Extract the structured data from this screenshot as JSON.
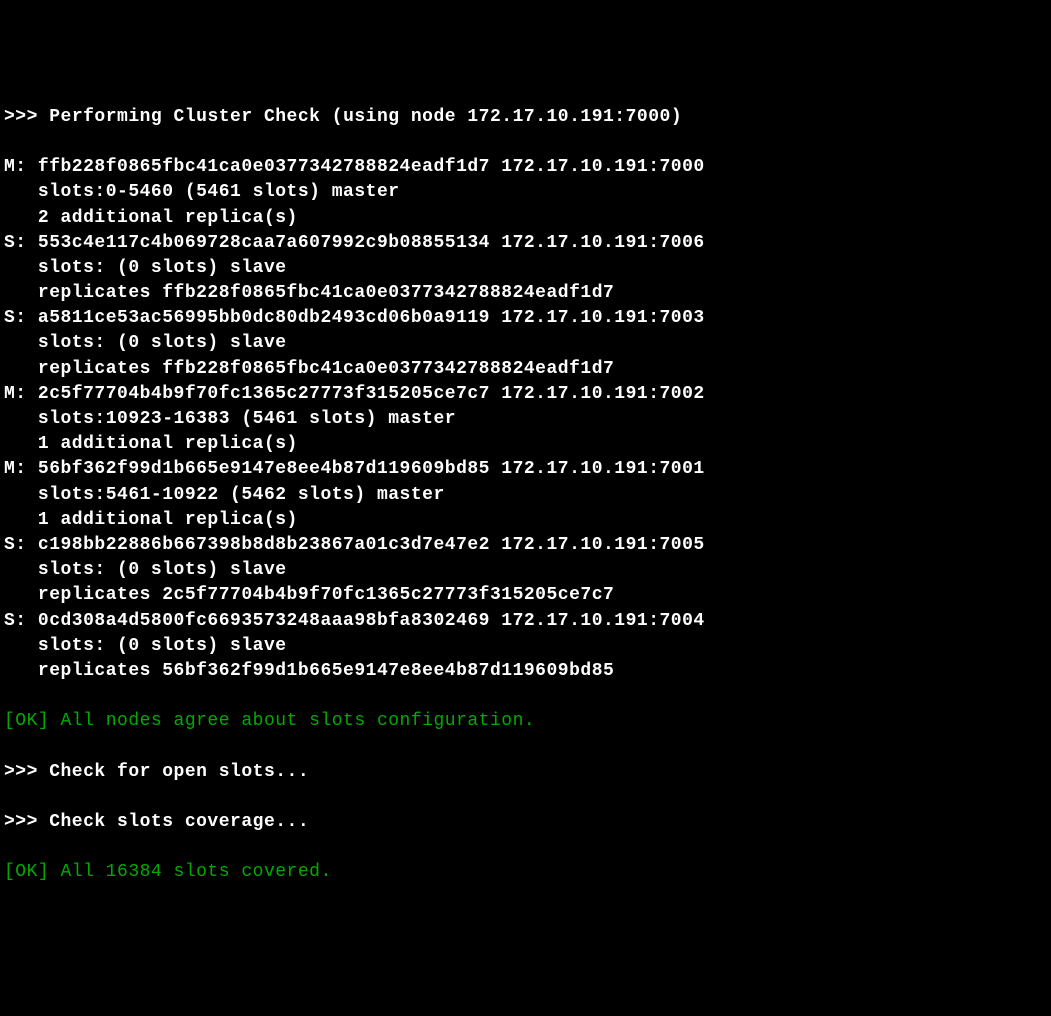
{
  "header": {
    "prefix": ">>> ",
    "title": "Performing Cluster Check (using node 172.17.10.191:7000)"
  },
  "nodes": [
    {
      "role": "M",
      "id": "ffb228f0865fbc41ca0e0377342788824eadf1d7",
      "address": "172.17.10.191:7000",
      "slots_line": "   slots:0-5460 (5461 slots) master",
      "replica_line": "   2 additional replica(s)"
    },
    {
      "role": "S",
      "id": "553c4e117c4b069728caa7a607992c9b08855134",
      "address": "172.17.10.191:7006",
      "slots_line": "   slots: (0 slots) slave",
      "replicates_line": "   replicates ffb228f0865fbc41ca0e0377342788824eadf1d7"
    },
    {
      "role": "S",
      "id": "a5811ce53ac56995bb0dc80db2493cd06b0a9119",
      "address": "172.17.10.191:7003",
      "slots_line": "   slots: (0 slots) slave",
      "replicates_line": "   replicates ffb228f0865fbc41ca0e0377342788824eadf1d7"
    },
    {
      "role": "M",
      "id": "2c5f77704b4b9f70fc1365c27773f315205ce7c7",
      "address": "172.17.10.191:7002",
      "slots_line": "   slots:10923-16383 (5461 slots) master",
      "replica_line": "   1 additional replica(s)"
    },
    {
      "role": "M",
      "id": "56bf362f99d1b665e9147e8ee4b87d119609bd85",
      "address": "172.17.10.191:7001",
      "slots_line": "   slots:5461-10922 (5462 slots) master",
      "replica_line": "   1 additional replica(s)"
    },
    {
      "role": "S",
      "id": "c198bb22886b667398b8d8b23867a01c3d7e47e2",
      "address": "172.17.10.191:7005",
      "slots_line": "   slots: (0 slots) slave",
      "replicates_line": "   replicates 2c5f77704b4b9f70fc1365c27773f315205ce7c7"
    },
    {
      "role": "S",
      "id": "0cd308a4d5800fc6693573248aaa98bfa8302469",
      "address": "172.17.10.191:7004",
      "slots_line": "   slots: (0 slots) slave",
      "replicates_line": "   replicates 56bf362f99d1b665e9147e8ee4b87d119609bd85"
    }
  ],
  "status": {
    "ok1": "[OK] All nodes agree about slots configuration.",
    "check_open": ">>> Check for open slots...",
    "check_coverage": ">>> Check slots coverage...",
    "ok2": "[OK] All 16384 slots covered."
  }
}
